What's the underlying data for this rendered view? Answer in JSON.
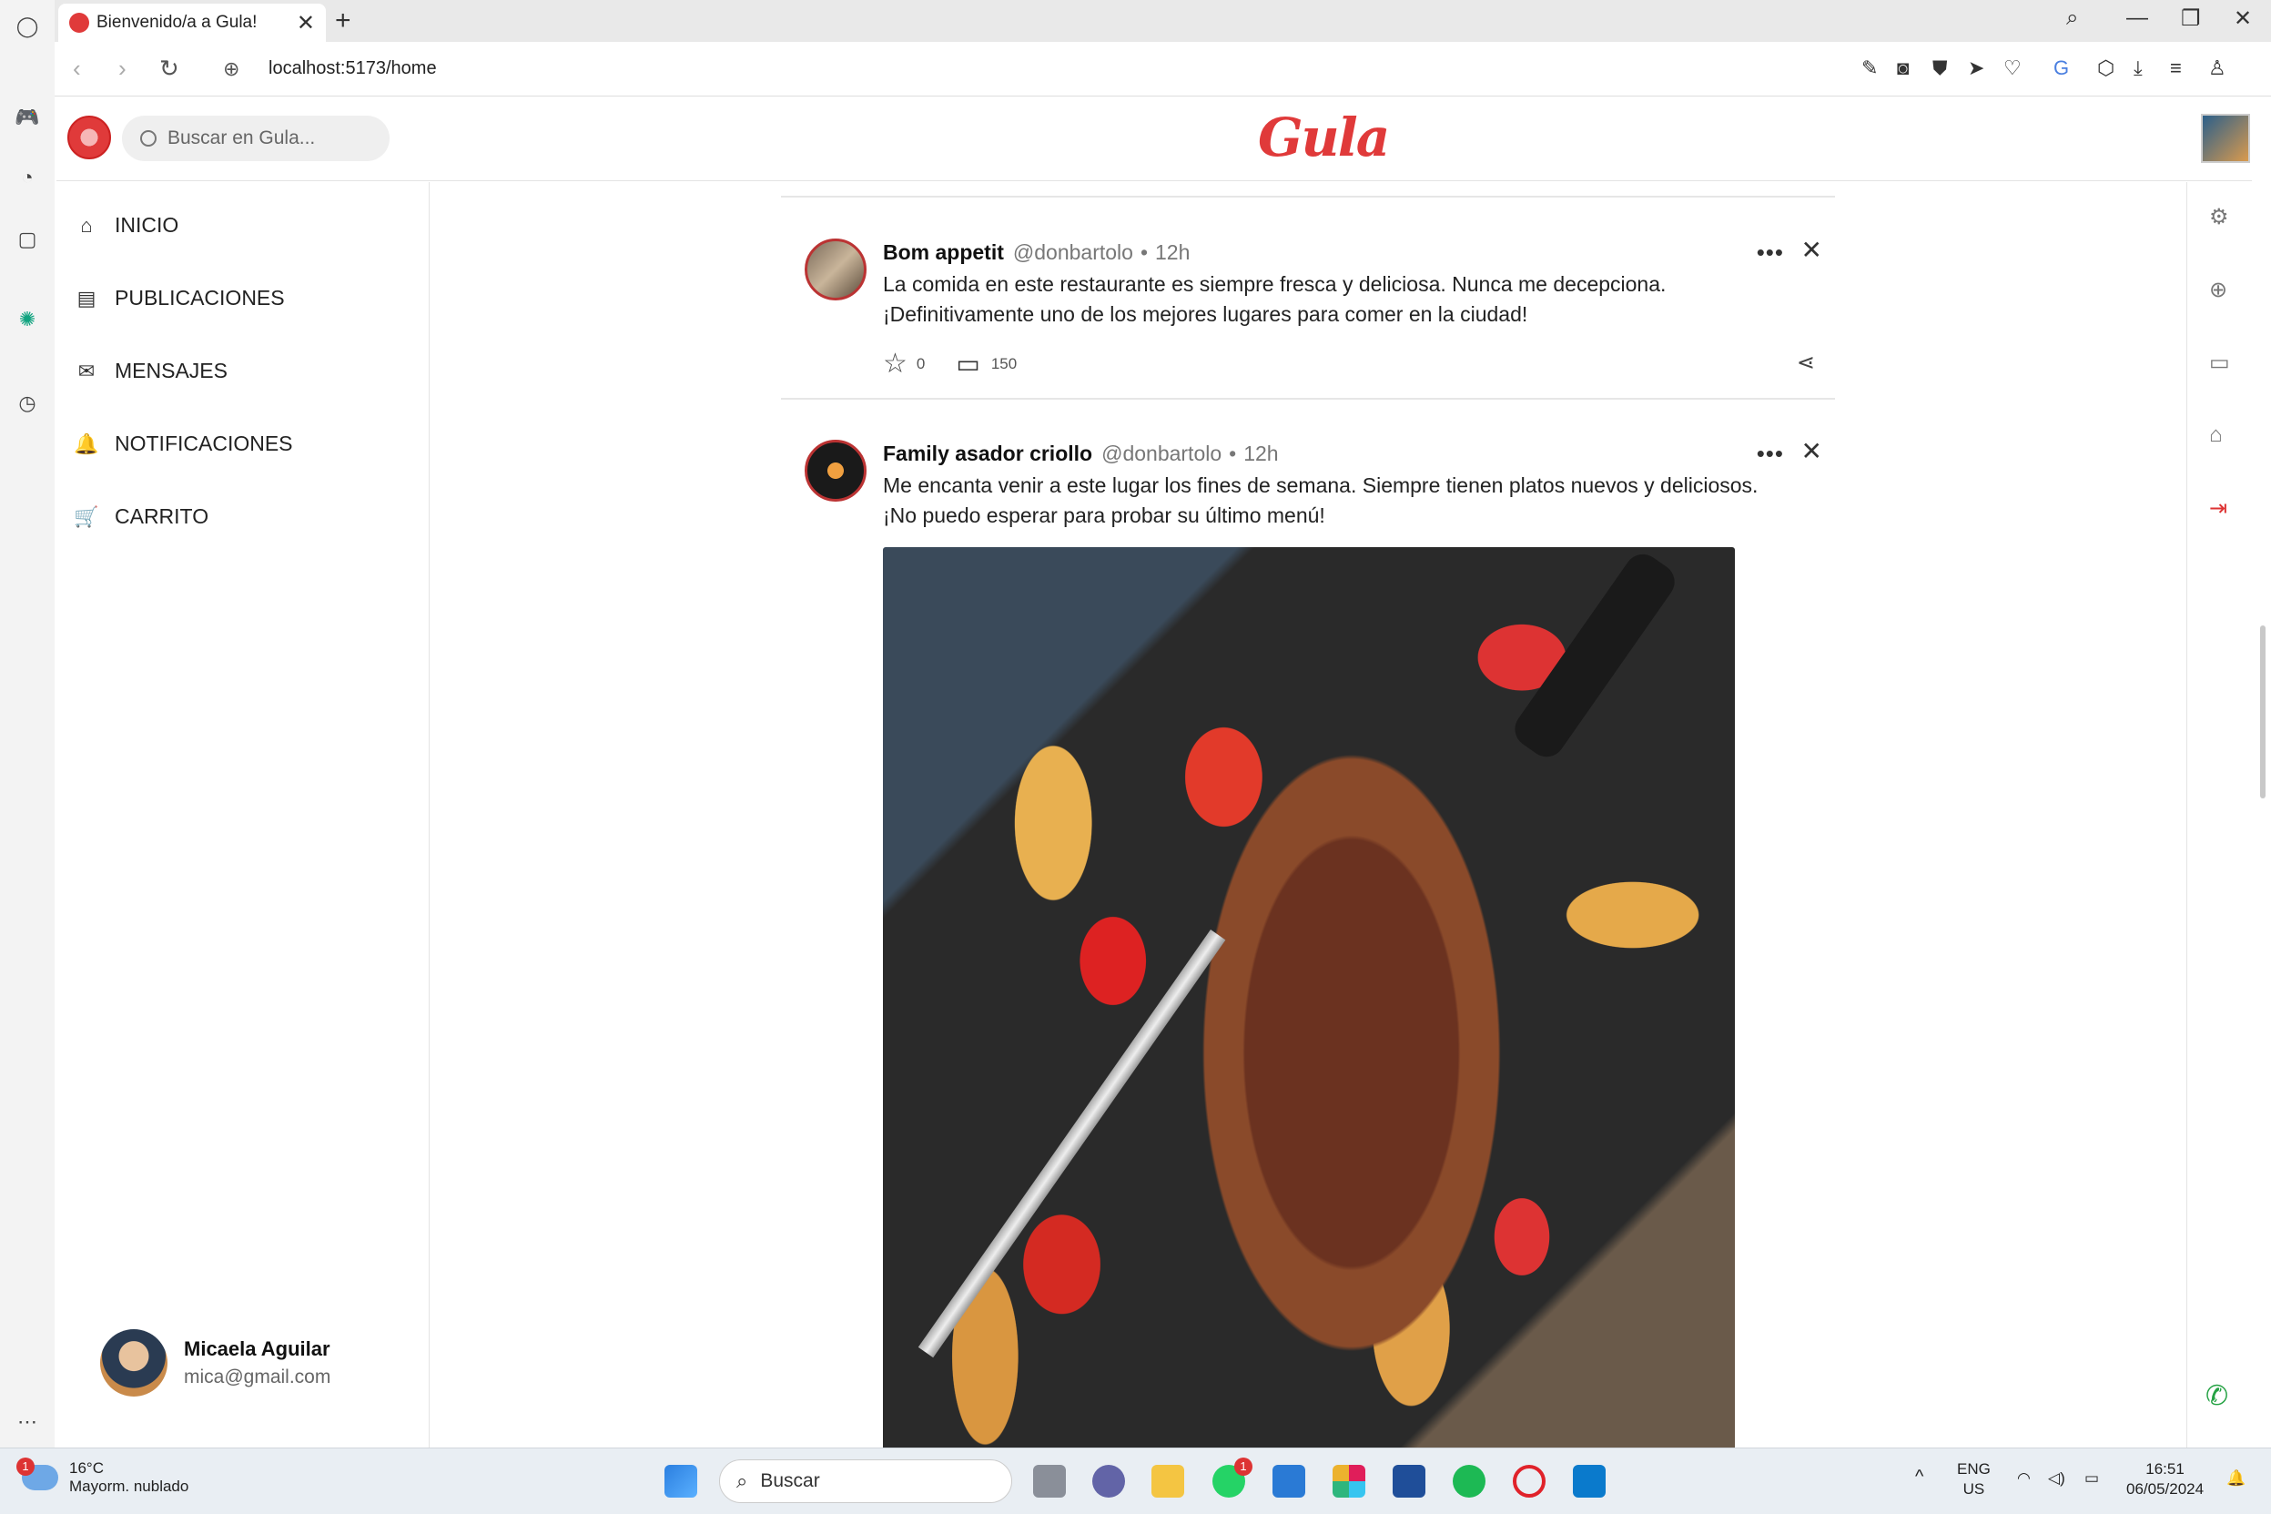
{
  "browser": {
    "tab_title": "Bienvenido/a a Gula!",
    "url": "localhost:5173/home"
  },
  "app": {
    "brand": "Gula",
    "search_placeholder": "Buscar en Gula...",
    "nav": [
      {
        "label": "INICIO",
        "icon": "home-icon"
      },
      {
        "label": "PUBLICACIONES",
        "icon": "book-icon"
      },
      {
        "label": "MENSAJES",
        "icon": "envelope-icon"
      },
      {
        "label": "NOTIFICACIONES",
        "icon": "bell-icon"
      },
      {
        "label": "CARRITO",
        "icon": "cart-icon"
      }
    ],
    "user": {
      "name": "Micaela Aguilar",
      "email": "mica@gmail.com"
    },
    "right_rail_icons": [
      "gear-icon",
      "globe-icon",
      "card-icon",
      "store-icon",
      "logout-icon",
      "whatsapp-icon"
    ],
    "accent_color": "#e03a3a"
  },
  "feed": {
    "posts": [
      {
        "name": "Bom appetit",
        "handle": "@donbartolo",
        "time": "12h",
        "text_line1": "La comida en este restaurante es siempre fresca y deliciosa. Nunca me decepciona.",
        "text_line2": "¡Definitivamente uno de los mejores lugares para comer en la ciudad!",
        "stars": "0",
        "comments": "150"
      },
      {
        "name": "Family asador criollo",
        "handle": "@donbartolo",
        "time": "12h",
        "text_line1": "Me encanta venir a este lugar los fines de semana. Siempre tienen platos nuevos y deliciosos.",
        "text_line2": "¡No puedo esperar para probar su último menú!"
      }
    ]
  },
  "taskbar": {
    "weather_temp": "16°C",
    "weather_desc": "Mayorm. nublado",
    "weather_badge": "1",
    "search_placeholder": "Buscar",
    "whatsapp_badge": "1",
    "lang_top": "ENG",
    "lang_bottom": "US",
    "time": "16:51",
    "date": "06/05/2024"
  }
}
